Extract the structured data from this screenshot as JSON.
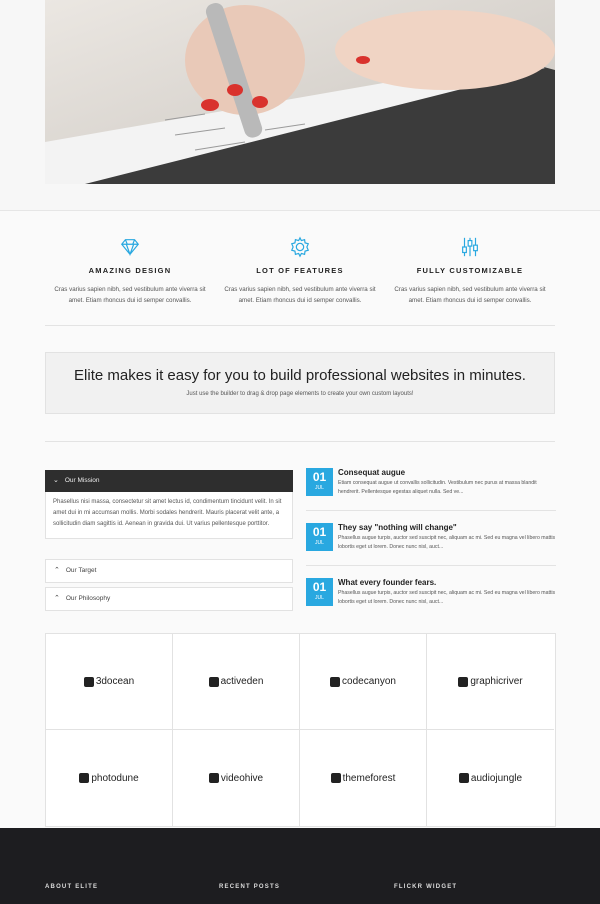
{
  "features": [
    {
      "icon": "diamond-icon",
      "title": "AMAZING DESIGN",
      "text": "Cras varius sapien nibh, sed vestibulum ante viverra sit amet. Etiam rhoncus dui id semper convallis."
    },
    {
      "icon": "gear-icon",
      "title": "LOT OF FEATURES",
      "text": "Cras varius sapien nibh, sed vestibulum ante viverra sit amet. Etiam rhoncus dui id semper convallis."
    },
    {
      "icon": "sliders-icon",
      "title": "FULLY CUSTOMIZABLE",
      "text": "Cras varius sapien nibh, sed vestibulum ante viverra sit amet. Etiam rhoncus dui id semper convallis."
    }
  ],
  "callout": {
    "heading": "Elite makes it easy for you to build professional websites in minutes.",
    "subtext": "Just use the builder to drag & drop page elements to create your own custom layouts!"
  },
  "accordion": [
    {
      "label": "Our Mission",
      "open": true,
      "body": "Phasellus nisi massa, consectetur sit amet lectus id, condimentum tincidunt velit. In sit amet dui in mi accumsan mollis. Morbi sodales hendrerit. Mauris placerat velit ante, a sollicitudin diam sagittis id. Aenean in gravida dui. Ut varius pellentesque porttitor."
    },
    {
      "label": "Our Target",
      "open": false
    },
    {
      "label": "Our Philosophy",
      "open": false
    }
  ],
  "posts": [
    {
      "day": "01",
      "month": "JUL",
      "title": "Consequat augue",
      "excerpt": "Etiam consequat augue ut convallis sollicitudin. Vestibulum nec purus at massa blandit hendrerit. Pellentesque egestas aliquet nulla. Sed ve..."
    },
    {
      "day": "01",
      "month": "JUL",
      "title": "They say \"nothing will change\"",
      "excerpt": "Phasellus augue turpis, auctor sed suscipit nec, aliquam ac mi. Sed eu magna vel libero mattis lobortis eget ut lorem. Donec nunc nisl, auct..."
    },
    {
      "day": "01",
      "month": "JUL",
      "title": "What every founder fears.",
      "excerpt": "Phasellus augue turpis, auctor sed suscipit nec, aliquam ac mi. Sed eu magna vel libero mattis lobortis eget ut lorem. Donec nunc nisl, auct..."
    }
  ],
  "clients": [
    "3docean",
    "activeden",
    "codecanyon",
    "graphicriver",
    "photodune",
    "videohive",
    "themeforest",
    "audiojungle"
  ],
  "footer": {
    "col1": "ABOUT ELITE",
    "col2": "RECENT POSTS",
    "col3": "FLICKR WIDGET"
  },
  "colors": {
    "accent": "#29a8e0",
    "dark": "#2e2e2e",
    "footer": "#1d1d20"
  }
}
